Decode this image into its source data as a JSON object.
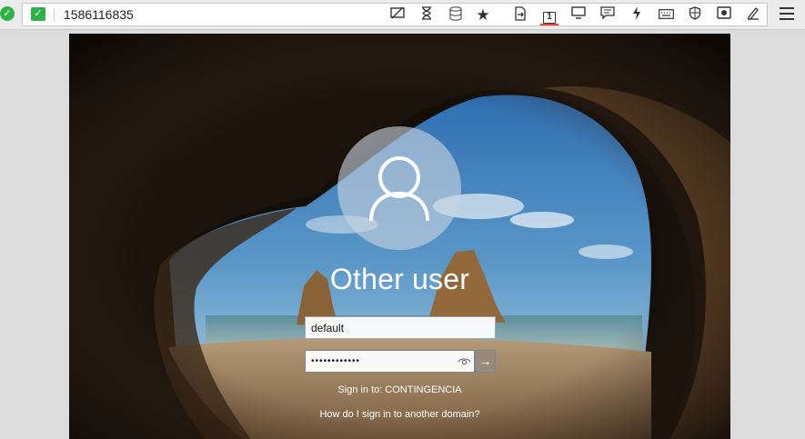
{
  "toolbar": {
    "connection_id": "1586116835",
    "status_icon": "check-circle-icon",
    "secure_icon": "shield-check-icon",
    "icons": [
      {
        "name": "hide-remote-cursor-icon",
        "glyph": "⧄"
      },
      {
        "name": "hourglass-icon",
        "glyph": "⧗"
      },
      {
        "name": "database-icon",
        "glyph": "⛁"
      },
      {
        "name": "star-icon",
        "glyph": "★"
      },
      {
        "name": "file-transfer-icon",
        "glyph": "⇥"
      },
      {
        "name": "monitor-1-icon",
        "glyph": "1"
      },
      {
        "name": "display-icon",
        "glyph": "▭"
      },
      {
        "name": "chat-icon",
        "glyph": "▤"
      },
      {
        "name": "lightning-icon",
        "glyph": "ϟ"
      },
      {
        "name": "keyboard-icon",
        "glyph": "⌨"
      },
      {
        "name": "shield-icon",
        "glyph": "⛉"
      },
      {
        "name": "record-icon",
        "glyph": "◙"
      },
      {
        "name": "pen-icon",
        "glyph": "✎"
      }
    ],
    "menu_icon": "hamburger-menu-icon",
    "colors": {
      "status_green": "#2db24a",
      "active_underline": "#e0413b"
    }
  },
  "login": {
    "title": "Other user",
    "username_value": "default",
    "password_value": "••••••••••••",
    "signin_to": "Sign in to: CONTINGENCIA",
    "domain_link": "How do I sign in to another domain?",
    "submit_icon": "arrow-right-icon",
    "reveal_icon": "eye-icon",
    "avatar_icon": "user-icon"
  }
}
